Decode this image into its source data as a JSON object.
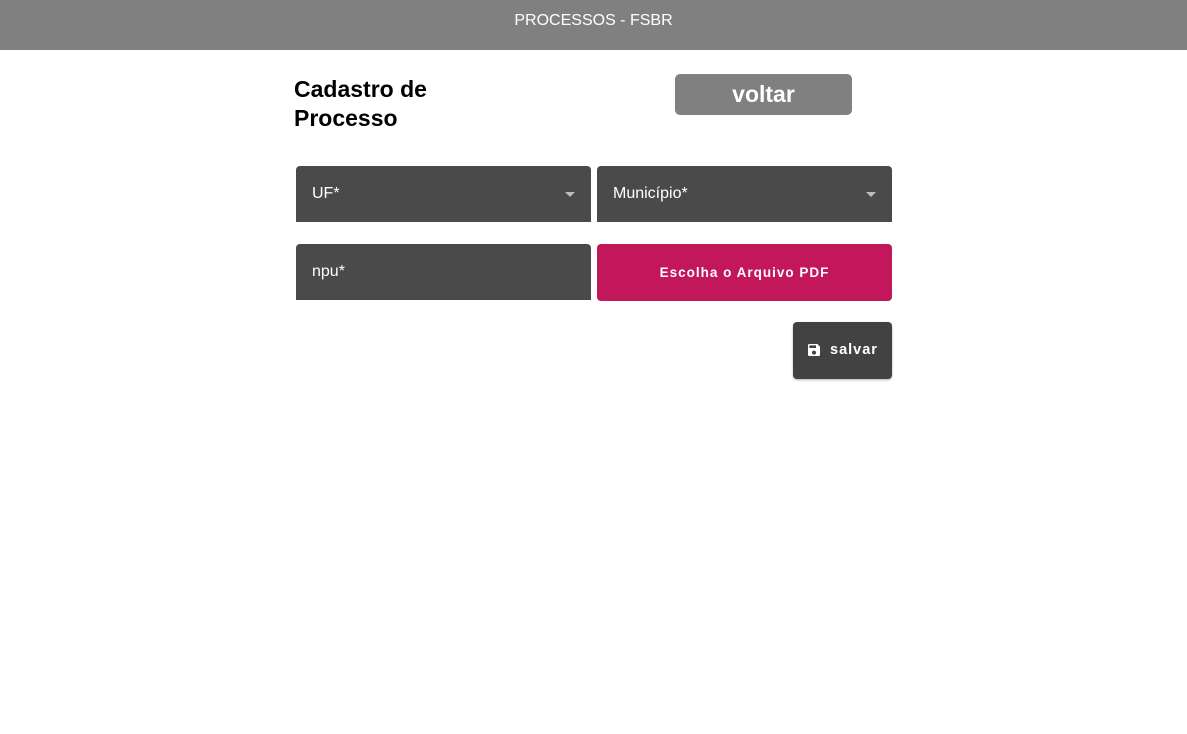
{
  "header": {
    "title": "PROCESSOS - FSBR"
  },
  "page": {
    "title": "Cadastro de Processo"
  },
  "actions": {
    "back_label": "voltar",
    "upload_label": "Escolha o Arquivo PDF",
    "save_label": "salvar"
  },
  "form": {
    "uf": {
      "label": "UF*"
    },
    "municipio": {
      "label": "Município*"
    },
    "npu": {
      "label": "npu*"
    }
  },
  "icons": {
    "dropdown": "chevron-down-icon",
    "save": "save-icon"
  },
  "colors": {
    "header_bg": "#808080",
    "field_bg": "#4a4a4a",
    "upload_bg": "#c2185b",
    "save_bg": "#424242"
  }
}
